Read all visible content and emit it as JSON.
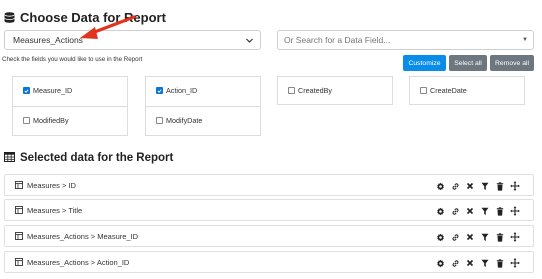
{
  "choose_section": {
    "title": "Choose Data for Report",
    "selected_table": "Measures_Actions",
    "search_placeholder": "Or Search for a Data Field...",
    "hint": "Check the fields you would like to use in the Report",
    "buttons": {
      "customize": "Customize",
      "select_all": "Select all",
      "remove_all": "Remove all"
    },
    "fields": [
      {
        "label": "Measure_ID",
        "checked": true
      },
      {
        "label": "ModifiedBy",
        "checked": false
      },
      {
        "label": "Action_ID",
        "checked": true
      },
      {
        "label": "ModifyDate",
        "checked": false
      },
      {
        "label": "CreatedBy",
        "checked": false
      },
      {
        "label": "CreateDate",
        "checked": false
      }
    ]
  },
  "selected_section": {
    "title": "Selected data for the Report",
    "rows": [
      {
        "label": "Measures > ID"
      },
      {
        "label": "Measures > Title"
      },
      {
        "label": "Measures_Actions > Measure_ID"
      },
      {
        "label": "Measures_Actions > Action_ID"
      }
    ],
    "actions": [
      "gear-icon",
      "link-icon",
      "remove-icon",
      "filter-icon",
      "trash-icon",
      "move-icon"
    ]
  },
  "colors": {
    "primary": "#0a8de8",
    "secondary": "#6d7780",
    "annotation_arrow": "#e0341f",
    "checkbox": "#0a76d6"
  }
}
